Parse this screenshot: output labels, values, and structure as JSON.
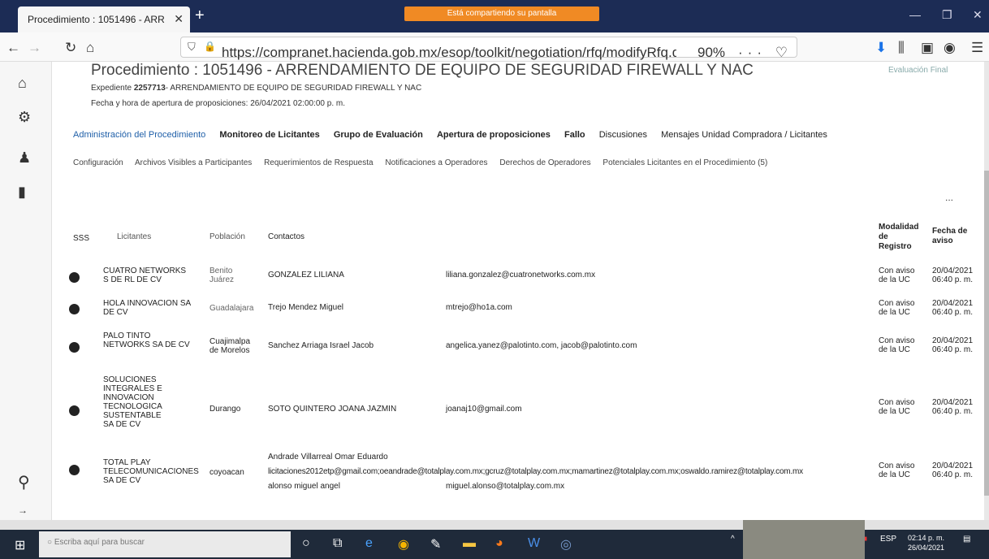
{
  "browser": {
    "tab_title": "Procedimiento : 1051496 - ARR",
    "share_banner": "Está compartiendo su pantalla",
    "url": "https://compranet.hacienda.gob.mx/esop/toolkit/negotiation/rfq/modifyRfq.do?userAct=changeTabSc...",
    "zoom": "90%"
  },
  "header": {
    "title": "Procedimiento : 1051496 - ARRENDAMIENTO DE EQUIPO DE SEGURIDAD FIREWALL Y NAC",
    "evaluacion_final": "Evaluación Final",
    "expediente_label": "Expediente",
    "expediente_number": "2257713",
    "expediente_desc": "- ARRENDAMIENTO DE EQUIPO DE SEGURIDAD FIREWALL Y NAC",
    "fecha_apertura": "Fecha y hora de apertura de proposiciones: 26/04/2021 02:00:00 p. m."
  },
  "tabs_main": [
    "Administración del Procedimiento",
    "Monitoreo de Licitantes",
    "Grupo de Evaluación",
    "Apertura de proposiciones",
    "Fallo",
    "Discusiones",
    "Mensajes Unidad Compradora / Licitantes"
  ],
  "tabs_sub": [
    "Configuración",
    "Archivos Visibles a Participantes",
    "Requerimientos de Respuesta",
    "Notificaciones a Operadores",
    "Derechos de Operadores",
    "Potenciales Licitantes en el Procedimiento (5)"
  ],
  "more_label": "...",
  "table": {
    "headers": {
      "sss": "SSS",
      "licitantes": "Licitantes",
      "poblacion": "Población",
      "contactos": "Contactos",
      "modalidad": "Modalidad de Registro",
      "fecha_aviso": "Fecha de aviso"
    },
    "rows": [
      {
        "licitante": "CUATRO NETWORKS S DE RL DE CV",
        "poblacion": "Benito Juárez",
        "contacto": "GONZALEZ LILIANA",
        "email": "liliana.gonzalez@cuatronetworks.com.mx",
        "modalidad": "Con aviso de la UC",
        "fecha": "20/04/2021 06:40 p. m."
      },
      {
        "licitante": "HOLA INNOVACION SA DE CV",
        "poblacion": "Guadalajara",
        "contacto": "Trejo Mendez Miguel",
        "email": "mtrejo@ho1a.com",
        "modalidad": "Con aviso de la UC",
        "fecha": "20/04/2021 06:40 p. m."
      },
      {
        "licitante": "PALO TINTO NETWORKS SA DE CV",
        "poblacion": "Cuajimalpa de Morelos",
        "contacto": "Sanchez Arriaga Israel Jacob",
        "email": "angelica.yanez@palotinto.com, jacob@palotinto.com",
        "modalidad": "Con aviso de la UC",
        "fecha": "20/04/2021 06:40 p. m."
      },
      {
        "licitante": "SOLUCIONES INTEGRALES E INNOVACION TECNOLOGICA SUSTENTABLE SA DE CV",
        "poblacion": "Durango",
        "contacto": "SOTO QUINTERO JOANA JAZMIN",
        "email": "joanaj10@gmail.com",
        "modalidad": "Con aviso de la UC",
        "fecha": "20/04/2021 06:40 p. m."
      },
      {
        "licitante": "TOTAL PLAY TELECOMUNICACIONES SA DE CV",
        "poblacion": "coyoacan",
        "contacto": "Andrade Villarreal Omar Eduardo",
        "emails_line": "licitaciones2012etp@gmail.com;oeandrade@totalplay.com.mx;gcruz@totalplay.com.mx;mamartinez@totalplay.com.mx;oswaldo.ramirez@totalplay.com.mx",
        "contacto2": "alonso miguel angel",
        "email2": "miguel.alonso@totalplay.com.mx",
        "modalidad": "Con aviso de la UC",
        "fecha": "20/04/2021 06:40 p. m."
      }
    ]
  },
  "taskbar": {
    "search_placeholder": "Escriba aquí para buscar",
    "lang": "ESP",
    "time": "02:14 p. m.",
    "date": "26/04/2021"
  }
}
